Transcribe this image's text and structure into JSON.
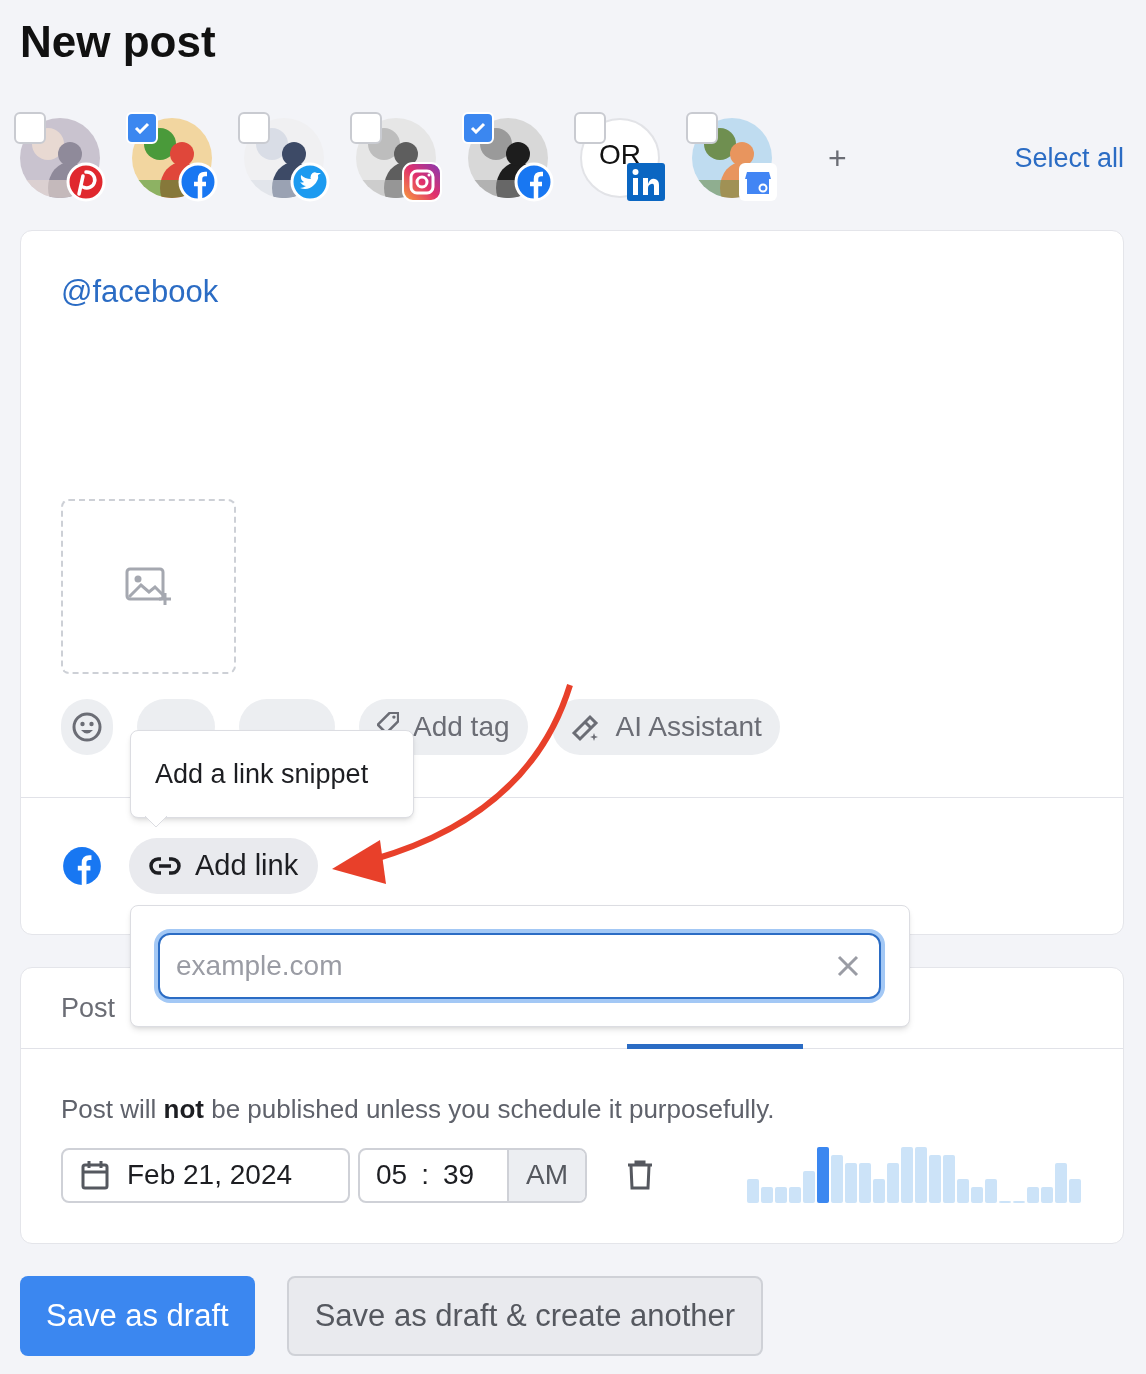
{
  "title": "New post",
  "accounts": [
    {
      "kind": "pinterest",
      "checked": false
    },
    {
      "kind": "facebook",
      "checked": true
    },
    {
      "kind": "twitter",
      "checked": false
    },
    {
      "kind": "instagram",
      "checked": false
    },
    {
      "kind": "facebook",
      "checked": true
    },
    {
      "kind": "linkedin",
      "initials": "OR",
      "checked": false
    },
    {
      "kind": "google-business",
      "checked": false
    }
  ],
  "add_account": "+",
  "select_all": "Select all",
  "composer": {
    "text": "@facebook",
    "tools": [
      {
        "kind": "emoji"
      },
      {
        "kind": "gif"
      },
      {
        "kind": "utm"
      },
      {
        "kind": "tag",
        "label": "Add tag"
      },
      {
        "kind": "ai",
        "label": "AI Assistant"
      }
    ]
  },
  "link_row": {
    "kind": "facebook",
    "button": "Add link"
  },
  "tooltip": "Add a link snippet",
  "link_popover": {
    "placeholder": "example.com"
  },
  "schedule": {
    "tabs": [
      {
        "label": "Post",
        "selected": false
      }
    ],
    "notice": "Post will **not** be published unless you schedule it purposefully.",
    "date": "Feb 21, 2024",
    "hour": "05",
    "separator": ":",
    "minute": "39",
    "period": "AM"
  },
  "buttons": [
    {
      "label": "Save as draft",
      "kind": "primary"
    },
    {
      "label": "Save as draft & create another",
      "kind": "secondary"
    }
  ]
}
